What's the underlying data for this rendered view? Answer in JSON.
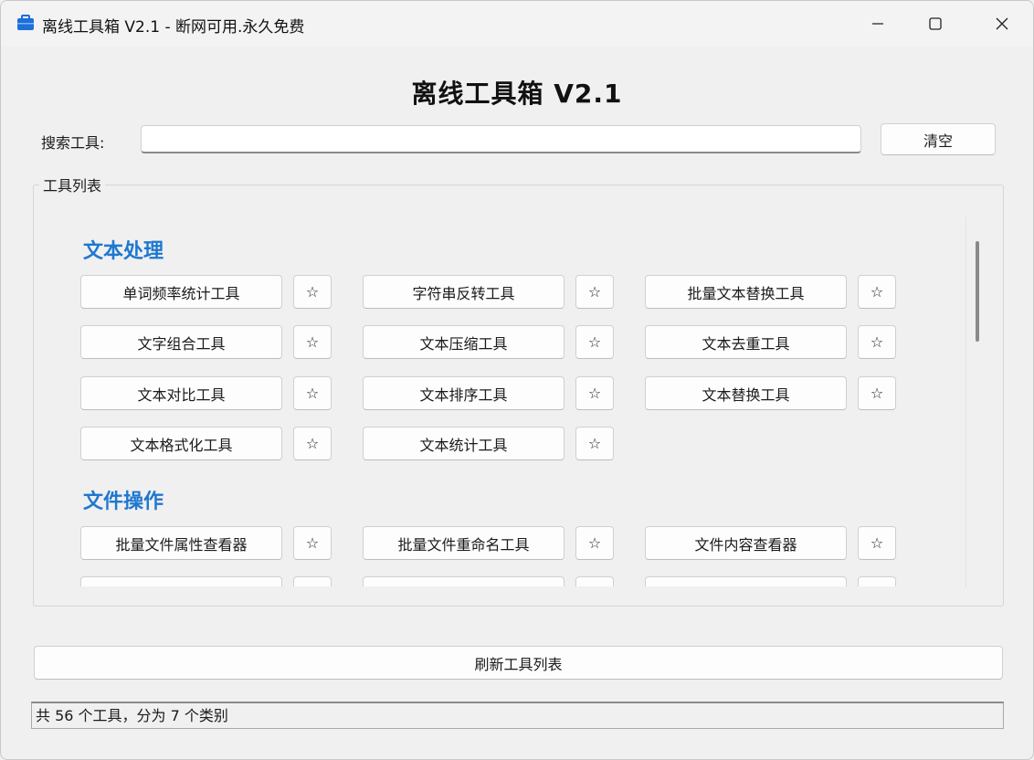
{
  "window": {
    "title": "离线工具箱 V2.1 - 断网可用.永久免费"
  },
  "header": {
    "title": "离线工具箱 V2.1"
  },
  "search": {
    "label": "搜索工具:",
    "value": "",
    "placeholder": "",
    "clear_label": "清空"
  },
  "group": {
    "label": "工具列表"
  },
  "star_glyph": "☆",
  "categories": [
    {
      "name": "文本处理",
      "tools": [
        "单词频率统计工具",
        "字符串反转工具",
        "批量文本替换工具",
        "文字组合工具",
        "文本压缩工具",
        "文本去重工具",
        "文本对比工具",
        "文本排序工具",
        "文本替换工具",
        "文本格式化工具",
        "文本统计工具"
      ]
    },
    {
      "name": "文件操作",
      "tools": [
        "批量文件属性查看器",
        "批量文件重命名工具",
        "文件内容查看器"
      ]
    }
  ],
  "refresh_label": "刷新工具列表",
  "status": "共 56 个工具，分为 7 个类别",
  "colors": {
    "category": "#1e78d0",
    "icon": "#1e6fd9"
  }
}
